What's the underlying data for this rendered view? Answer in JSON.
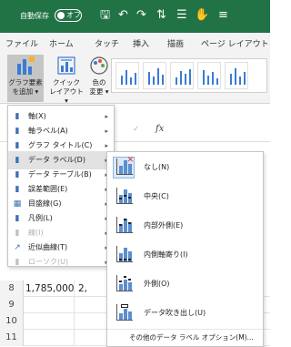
{
  "titlebar": {
    "autosave_label": "自動保存",
    "autosave_state": "オフ",
    "accent_color": "#217346",
    "icons": [
      "save-icon",
      "undo-icon",
      "redo-icon",
      "sort-icon",
      "quick-access-icon",
      "touch-mode-icon",
      "customize-icon"
    ]
  },
  "tabs": [
    "ファイル",
    "ホーム",
    "タッチ",
    "挿入",
    "描画",
    "ページ レイアウト"
  ],
  "ribbon": {
    "add_chart_element": "グラフ要素\nを追加 ▾",
    "quick_layout": "クイック\nレイアウト ▾",
    "change_colors": "色の\n変更 ▾"
  },
  "formula_bar": {
    "cancel": "×",
    "confirm": "✓",
    "fx": "fx"
  },
  "menu": {
    "items": [
      {
        "label": "軸(X)",
        "icon": "axes-icon",
        "disabled": false,
        "hover": false
      },
      {
        "label": "軸ラベル(A)",
        "icon": "axis-titles-icon",
        "disabled": false,
        "hover": false
      },
      {
        "label": "グラフ タイトル(C)",
        "icon": "chart-title-icon",
        "disabled": false,
        "hover": false
      },
      {
        "label": "データ ラベル(D)",
        "icon": "data-labels-icon",
        "disabled": false,
        "hover": true
      },
      {
        "label": "データ テーブル(B)",
        "icon": "data-table-icon",
        "disabled": false,
        "hover": false
      },
      {
        "label": "誤差範囲(E)",
        "icon": "error-bars-icon",
        "disabled": false,
        "hover": false
      },
      {
        "label": "目盛線(G)",
        "icon": "gridlines-icon",
        "disabled": false,
        "hover": false
      },
      {
        "label": "凡例(L)",
        "icon": "legend-icon",
        "disabled": false,
        "hover": false
      },
      {
        "label": "線(I)",
        "icon": "lines-icon",
        "disabled": true,
        "hover": false
      },
      {
        "label": "近似曲線(T)",
        "icon": "trendline-icon",
        "disabled": false,
        "hover": false
      },
      {
        "label": "ローソク(U)",
        "icon": "up-down-bars-icon",
        "disabled": true,
        "hover": false
      }
    ]
  },
  "submenu": {
    "items": [
      {
        "label": "なし(N)",
        "icon": "no-labels-icon",
        "selected": true
      },
      {
        "label": "中央(C)",
        "icon": "center-labels-icon",
        "selected": false
      },
      {
        "label": "内部外側(E)",
        "icon": "inside-end-labels-icon",
        "selected": false
      },
      {
        "label": "内側軸寄り(I)",
        "icon": "inside-base-labels-icon",
        "selected": false
      },
      {
        "label": "外側(O)",
        "icon": "outside-end-labels-icon",
        "selected": false
      },
      {
        "label": "データ吹き出し(U)",
        "icon": "data-callout-icon",
        "selected": false
      }
    ],
    "footer": "その他のデータ ラベル オプション(M)..."
  },
  "sheet": {
    "rows": [
      {
        "num": "8",
        "a": "1,785,000",
        "b": "2,"
      },
      {
        "num": "9",
        "a": "",
        "b": ""
      },
      {
        "num": "10",
        "a": "",
        "b": ""
      },
      {
        "num": "11",
        "a": "",
        "b": ""
      }
    ]
  }
}
